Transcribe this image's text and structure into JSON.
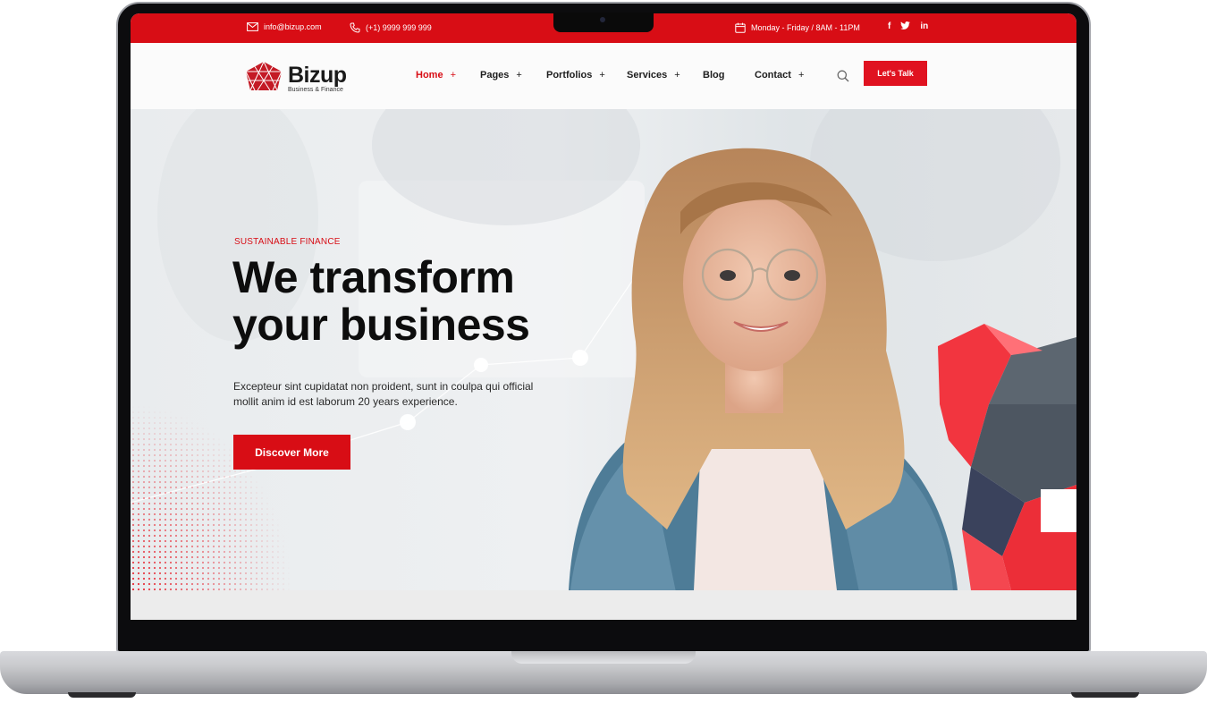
{
  "topbar": {
    "email": "info@bizup.com",
    "phone": "(+1) 9999 999 999",
    "hours": "Monday - Friday / 8AM - 11PM",
    "social": [
      "f",
      "t",
      "in"
    ],
    "colors": {
      "bar": "#d80d15"
    },
    "icons": [
      "envelope-icon",
      "phone-icon",
      "calendar-icon",
      "facebook-icon",
      "twitter-icon",
      "linkedin-icon"
    ]
  },
  "brand": {
    "name": "Bizup",
    "tagline": "Business & Finance",
    "logo_color": "#c41a25"
  },
  "nav": {
    "items": [
      {
        "label": "Home",
        "plus": "+",
        "active": true
      },
      {
        "label": "Pages",
        "plus": "+"
      },
      {
        "label": "Portfolios",
        "plus": "+"
      },
      {
        "label": "Services",
        "plus": "+"
      },
      {
        "label": "Blog",
        "plus": ""
      },
      {
        "label": "Contact",
        "plus": "+"
      }
    ],
    "search_icon": "search-icon",
    "cta_label": "Let's Talk"
  },
  "hero": {
    "eyebrow": "SUSTAINABLE FINANCE",
    "headline_line1": "We transform",
    "headline_line2": "your business",
    "paragraph": "Excepteur sint cupidatat non proident, sunt in coulpa qui official mollit anim id est laborum 20 years experience.",
    "button_label": "Discover More",
    "accent": "#d80d15"
  }
}
